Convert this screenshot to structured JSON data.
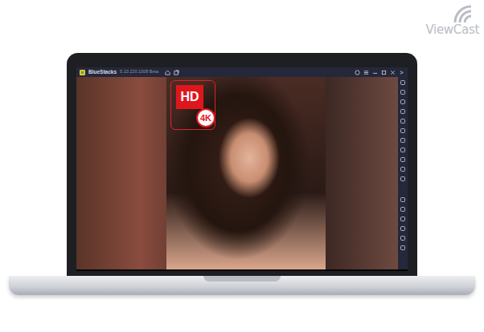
{
  "watermark": {
    "text": "ViewCast"
  },
  "window": {
    "title": "BlueStacks",
    "subtitle": "5.10.220.1008 Beta"
  },
  "app_badge": {
    "main": "HD",
    "sub": "4K"
  }
}
